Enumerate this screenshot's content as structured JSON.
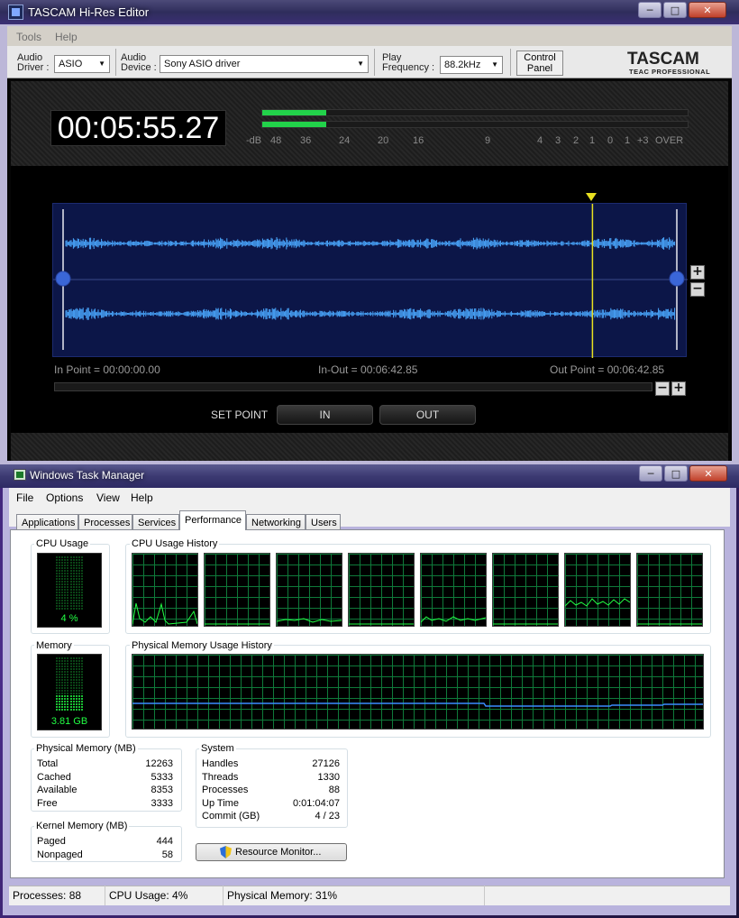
{
  "tascam": {
    "title": "TASCAM Hi-Res Editor",
    "menu": [
      "Tools",
      "Help"
    ],
    "audio_driver_label": "Audio\nDriver :",
    "audio_driver_value": "ASIO",
    "audio_device_label": "Audio\nDevice :",
    "audio_device_value": "Sony ASIO driver",
    "play_freq_label": "Play\nFrequency :",
    "play_freq_value": "88.2kHz",
    "control_panel_label": "Control\nPanel",
    "logo": "TASCAM",
    "logo_sub": "TEAC PROFESSIONAL",
    "time_display": "00:05:55.27",
    "meter": {
      "scale_labels": [
        "-dB",
        "48",
        "36",
        "24",
        "20",
        "16",
        "9",
        "4",
        "3",
        "2",
        "1",
        "0",
        "1",
        "+3",
        "OVER"
      ],
      "left_level": 0.15,
      "right_level": 0.15
    },
    "in_point": "In Point = 00:00:00.00",
    "in_out": "In-Out = 00:06:42.85",
    "out_point": "Out Point = 00:06:42.85",
    "playhead_fraction": 0.85,
    "zoom_in_label": "+",
    "zoom_out_label": "−",
    "set_point_label": "SET POINT",
    "in_button": "IN",
    "out_button": "OUT",
    "colors": {
      "meter_green": "#22d24a",
      "waveform": "#4aa8ff",
      "playhead": "#e8e020",
      "wave_bg": "#0c1648"
    }
  },
  "taskmgr": {
    "title": "Windows Task Manager",
    "menu": [
      "File",
      "Options",
      "View",
      "Help"
    ],
    "tabs": [
      "Applications",
      "Processes",
      "Services",
      "Performance",
      "Networking",
      "Users"
    ],
    "active_tab": "Performance",
    "cpu_usage_label": "CPU Usage",
    "cpu_usage_value": "4 %",
    "cpu_history_label": "CPU Usage History",
    "memory_label": "Memory",
    "memory_value": "3.81 GB",
    "phys_history_label": "Physical Memory Usage History",
    "physical_memory": {
      "title": "Physical Memory (MB)",
      "rows": [
        {
          "label": "Total",
          "value": "12263"
        },
        {
          "label": "Cached",
          "value": "5333"
        },
        {
          "label": "Available",
          "value": "8353"
        },
        {
          "label": "Free",
          "value": "3333"
        }
      ]
    },
    "kernel_memory": {
      "title": "Kernel Memory (MB)",
      "rows": [
        {
          "label": "Paged",
          "value": "444"
        },
        {
          "label": "Nonpaged",
          "value": "58"
        }
      ]
    },
    "system": {
      "title": "System",
      "rows": [
        {
          "label": "Handles",
          "value": "27126"
        },
        {
          "label": "Threads",
          "value": "1330"
        },
        {
          "label": "Processes",
          "value": "88"
        },
        {
          "label": "Up Time",
          "value": "0:01:04:07"
        },
        {
          "label": "Commit (GB)",
          "value": "4 / 23"
        }
      ]
    },
    "resource_monitor_button": "Resource Monitor...",
    "status": {
      "processes": "Processes: 88",
      "cpu": "CPU Usage: 4%",
      "memory": "Physical Memory: 31%"
    },
    "colors": {
      "graph_grid": "#0f7a3a",
      "graph_line": "#22ff44",
      "mem_line": "#3a8cff"
    }
  },
  "window_buttons": {
    "minimize": "─",
    "maximize": "□",
    "close": "✕"
  }
}
